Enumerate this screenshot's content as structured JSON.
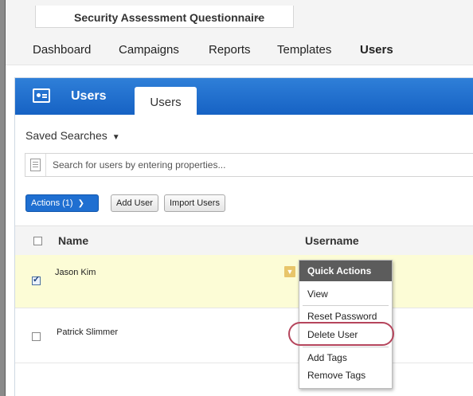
{
  "app": {
    "selector_label": "Security Assessment Questionnaire"
  },
  "nav": [
    "Dashboard",
    "Campaigns",
    "Reports",
    "Templates",
    "Users"
  ],
  "nav_active": "Users",
  "panel": {
    "title": "Users",
    "tab": "Users"
  },
  "saved_searches": "Saved Searches",
  "search": {
    "placeholder": "Search for users by entering properties..."
  },
  "toolbar": {
    "actions_label": "Actions (1)",
    "add_user_label": "Add User",
    "import_users_label": "Import Users"
  },
  "table": {
    "headers": {
      "name": "Name",
      "username": "Username"
    },
    "rows": [
      {
        "name": "Jason Kim",
        "selected": true
      },
      {
        "name": "Patrick Slimmer",
        "selected": false
      }
    ]
  },
  "quick_actions": {
    "title": "Quick Actions",
    "items": [
      "View",
      "Reset Password",
      "Delete User",
      "Add Tags",
      "Remove Tags"
    ],
    "highlighted": "Delete User"
  },
  "colors": {
    "brand_blue": "#1662c4",
    "selected_row": "#fcfcd6",
    "highlight_ring": "#b5455c"
  }
}
